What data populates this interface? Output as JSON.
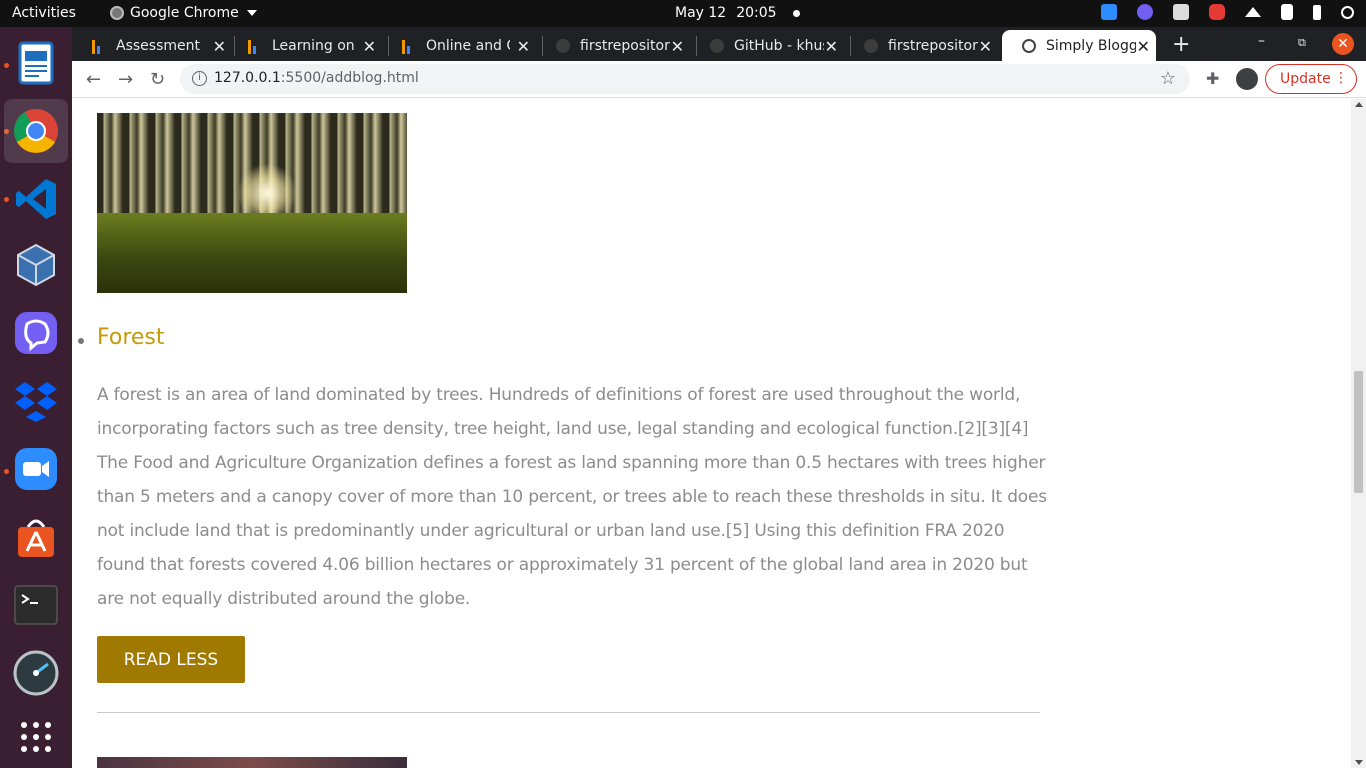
{
  "topbar": {
    "activities": "Activities",
    "app_name": "Google Chrome",
    "date": "May 12",
    "time": "20:05",
    "tray_icons": [
      "zoom-icon",
      "viber-icon",
      "dropbox-icon",
      "recorder-icon",
      "wifi-icon",
      "volume-icon",
      "battery-icon",
      "power-icon"
    ]
  },
  "dock": {
    "apps": [
      "libreoffice-writer-icon",
      "chrome-icon",
      "vscode-icon",
      "virtualbox-icon",
      "viber-icon",
      "dropbox-icon",
      "zoom-icon",
      "software-center-icon",
      "terminal-icon",
      "system-monitor-icon",
      "show-apps-icon"
    ]
  },
  "browser": {
    "tabs": [
      {
        "title": "Assessment"
      },
      {
        "title": "Learning on S"
      },
      {
        "title": "Online and Cl"
      },
      {
        "title": "firstrepositor"
      },
      {
        "title": "GitHub - khus"
      },
      {
        "title": "firstrepositor"
      },
      {
        "title": "Simply Blogg"
      }
    ],
    "url_host": "127.0.0.1",
    "url_rest": ":5500/addblog.html",
    "update_label": "Update"
  },
  "post": {
    "title": "Forest",
    "body": "A forest is an area of land dominated by trees. Hundreds of definitions of forest are used throughout the world, incorporating factors such as tree density, tree height, land use, legal standing and ecological function.[2][3][4] The Food and Agriculture Organization defines a forest as land spanning more than 0.5 hectares with trees higher than 5 meters and a canopy cover of more than 10 percent, or trees able to reach these thresholds in situ. It does not include land that is predominantly under agricultural or urban land use.[5] Using this definition FRA 2020 found that forests covered 4.06 billion hectares or approximately 31 percent of the global land area in 2020 but are not equally distributed around the globe.",
    "button_label": "READ LESS"
  },
  "colors": {
    "title": "#c59a09",
    "button": "#a07a00",
    "body_text": "#8c8c8c",
    "dock": "#3a1f33"
  }
}
